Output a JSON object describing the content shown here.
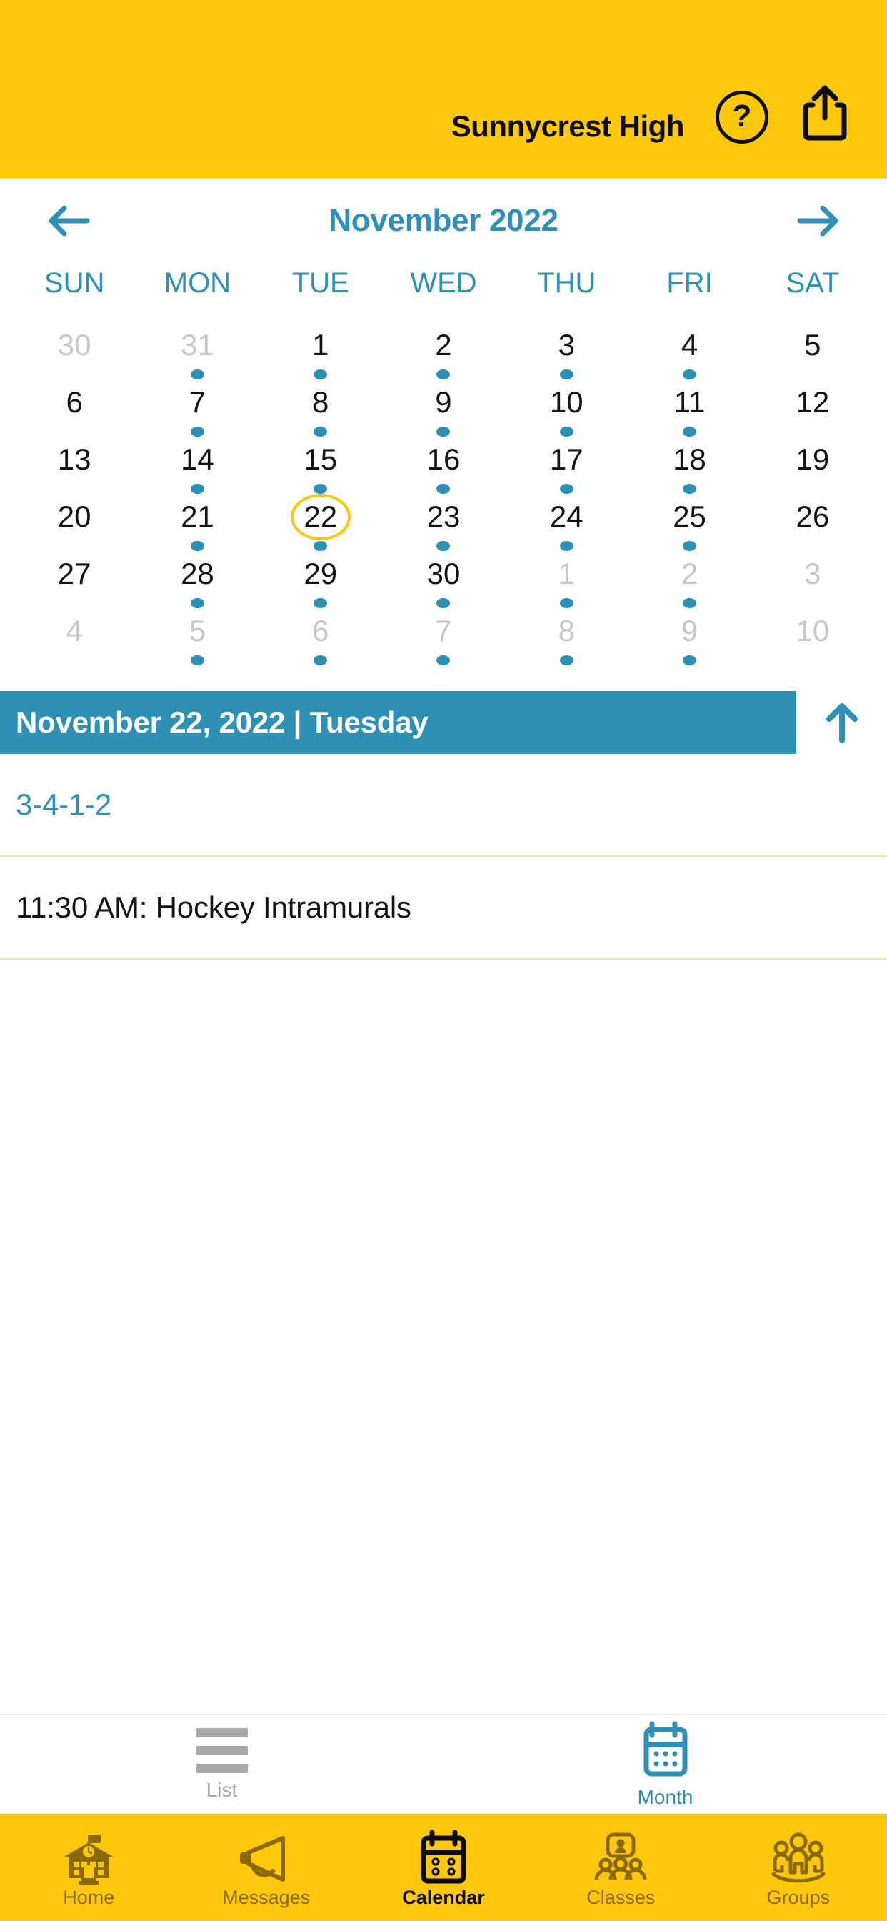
{
  "header": {
    "title": "Sunnycrest High",
    "help_icon": "question-mark-circle-icon",
    "help_glyph": "?",
    "share_icon": "share-icon",
    "background_color": "#FFC80D"
  },
  "calendar": {
    "month_label": "November 2022",
    "prev_icon": "arrow-left-icon",
    "next_icon": "arrow-right-icon",
    "accent_color": "#2d90b4",
    "selected_ring_color": "#FFC80D",
    "weekdays": [
      "SUN",
      "MON",
      "TUE",
      "WED",
      "THU",
      "FRI",
      "SAT"
    ],
    "weeks": [
      [
        {
          "day": "30",
          "muted": true,
          "dot": false,
          "selected": false
        },
        {
          "day": "31",
          "muted": true,
          "dot": true,
          "selected": false
        },
        {
          "day": "1",
          "muted": false,
          "dot": true,
          "selected": false
        },
        {
          "day": "2",
          "muted": false,
          "dot": true,
          "selected": false
        },
        {
          "day": "3",
          "muted": false,
          "dot": true,
          "selected": false
        },
        {
          "day": "4",
          "muted": false,
          "dot": true,
          "selected": false
        },
        {
          "day": "5",
          "muted": false,
          "dot": false,
          "selected": false
        }
      ],
      [
        {
          "day": "6",
          "muted": false,
          "dot": false,
          "selected": false
        },
        {
          "day": "7",
          "muted": false,
          "dot": true,
          "selected": false
        },
        {
          "day": "8",
          "muted": false,
          "dot": true,
          "selected": false
        },
        {
          "day": "9",
          "muted": false,
          "dot": true,
          "selected": false
        },
        {
          "day": "10",
          "muted": false,
          "dot": true,
          "selected": false
        },
        {
          "day": "11",
          "muted": false,
          "dot": true,
          "selected": false
        },
        {
          "day": "12",
          "muted": false,
          "dot": false,
          "selected": false
        }
      ],
      [
        {
          "day": "13",
          "muted": false,
          "dot": false,
          "selected": false
        },
        {
          "day": "14",
          "muted": false,
          "dot": true,
          "selected": false
        },
        {
          "day": "15",
          "muted": false,
          "dot": true,
          "selected": false
        },
        {
          "day": "16",
          "muted": false,
          "dot": true,
          "selected": false
        },
        {
          "day": "17",
          "muted": false,
          "dot": true,
          "selected": false
        },
        {
          "day": "18",
          "muted": false,
          "dot": true,
          "selected": false
        },
        {
          "day": "19",
          "muted": false,
          "dot": false,
          "selected": false
        }
      ],
      [
        {
          "day": "20",
          "muted": false,
          "dot": false,
          "selected": false
        },
        {
          "day": "21",
          "muted": false,
          "dot": true,
          "selected": false
        },
        {
          "day": "22",
          "muted": false,
          "dot": true,
          "selected": true
        },
        {
          "day": "23",
          "muted": false,
          "dot": true,
          "selected": false
        },
        {
          "day": "24",
          "muted": false,
          "dot": true,
          "selected": false
        },
        {
          "day": "25",
          "muted": false,
          "dot": true,
          "selected": false
        },
        {
          "day": "26",
          "muted": false,
          "dot": false,
          "selected": false
        }
      ],
      [
        {
          "day": "27",
          "muted": false,
          "dot": false,
          "selected": false
        },
        {
          "day": "28",
          "muted": false,
          "dot": true,
          "selected": false
        },
        {
          "day": "29",
          "muted": false,
          "dot": true,
          "selected": false
        },
        {
          "day": "30",
          "muted": false,
          "dot": true,
          "selected": false
        },
        {
          "day": "1",
          "muted": true,
          "dot": true,
          "selected": false
        },
        {
          "day": "2",
          "muted": true,
          "dot": true,
          "selected": false
        },
        {
          "day": "3",
          "muted": true,
          "dot": false,
          "selected": false
        }
      ],
      [
        {
          "day": "4",
          "muted": true,
          "dot": false,
          "selected": false
        },
        {
          "day": "5",
          "muted": true,
          "dot": true,
          "selected": false
        },
        {
          "day": "6",
          "muted": true,
          "dot": true,
          "selected": false
        },
        {
          "day": "7",
          "muted": true,
          "dot": true,
          "selected": false
        },
        {
          "day": "8",
          "muted": true,
          "dot": true,
          "selected": false
        },
        {
          "day": "9",
          "muted": true,
          "dot": true,
          "selected": false
        },
        {
          "day": "10",
          "muted": true,
          "dot": false,
          "selected": false
        }
      ]
    ]
  },
  "day_banner": {
    "text": "November 22, 2022 | Tuesday",
    "background_color": "#2d90b4",
    "collapse_icon": "arrow-up-icon"
  },
  "events": [
    {
      "text": "3-4-1-2",
      "accent": true
    },
    {
      "text": "11:30 AM: Hockey Intramurals",
      "accent": false
    }
  ],
  "view_toggle": [
    {
      "label": "List",
      "icon": "list-lines-icon",
      "active": false
    },
    {
      "label": "Month",
      "icon": "calendar-icon",
      "active": true
    }
  ],
  "tabbar": [
    {
      "label": "Home",
      "icon": "school-house-icon",
      "active": false
    },
    {
      "label": "Messages",
      "icon": "megaphone-icon",
      "active": false
    },
    {
      "label": "Calendar",
      "icon": "calendar-icon",
      "active": true
    },
    {
      "label": "Classes",
      "icon": "classes-people-icon",
      "active": false
    },
    {
      "label": "Groups",
      "icon": "groups-people-icon",
      "active": false
    }
  ]
}
